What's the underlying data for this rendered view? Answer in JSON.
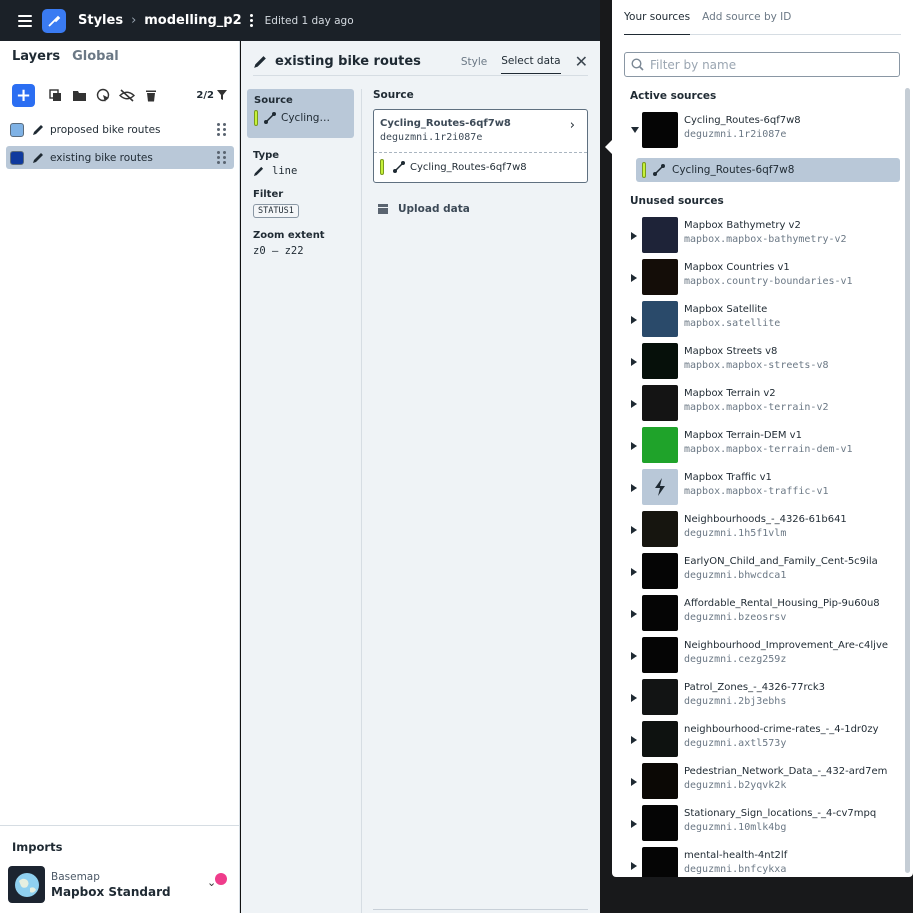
{
  "topbar": {
    "styles_label": "Styles",
    "style_name": "modelling_p2",
    "edited": "Edited 1 day ago"
  },
  "left": {
    "tabs": [
      "Layers",
      "Global"
    ],
    "count": "2/2",
    "layers": [
      {
        "name": "proposed bike routes",
        "color": "#7fb2e5",
        "selected": false
      },
      {
        "name": "existing bike routes",
        "color": "#0f3a9e",
        "selected": true
      }
    ],
    "imports": {
      "title": "Imports",
      "label": "Basemap",
      "name": "Mapbox Standard"
    }
  },
  "middle": {
    "title": "existing bike routes",
    "tabs": {
      "style": "Style",
      "select_data": "Select data"
    },
    "props": {
      "source_h": "Source",
      "source_val": "Cycling…",
      "type_h": "Type",
      "type_val": "line",
      "filter_h": "Filter",
      "filter_val": "STATUS1",
      "zoom_h": "Zoom extent",
      "zoom_val": "z0 – z22"
    },
    "source": {
      "header": "Source",
      "card_title": "Cycling_Routes-6qf7w8",
      "card_id": "deguzmni.1r2i087e",
      "card_layer": "Cycling_Routes-6qf7w8",
      "upload": "Upload data"
    }
  },
  "right": {
    "tabs": {
      "your_sources": "Your sources",
      "add_by_id": "Add source by ID"
    },
    "filter_placeholder": "Filter by name",
    "active_h": "Active sources",
    "active": {
      "name": "Cycling_Routes-6qf7w8",
      "id": "deguzmni.1r2i087e",
      "layer": "Cycling_Routes-6qf7w8"
    },
    "unused_h": "Unused sources",
    "unused": [
      {
        "name": "Mapbox Bathymetry v2",
        "id": "mapbox.mapbox-bathymetry-v2",
        "thumb": "#1e2338"
      },
      {
        "name": "Mapbox Countries v1",
        "id": "mapbox.country-boundaries-v1",
        "thumb": "#140d08"
      },
      {
        "name": "Mapbox Satellite",
        "id": "mapbox.satellite",
        "thumb": "#2a4a6a"
      },
      {
        "name": "Mapbox Streets v8",
        "id": "mapbox.mapbox-streets-v8",
        "thumb": "#06100a"
      },
      {
        "name": "Mapbox Terrain v2",
        "id": "mapbox.mapbox-terrain-v2",
        "thumb": "#141414"
      },
      {
        "name": "Mapbox Terrain-DEM v1",
        "id": "mapbox.mapbox-terrain-dem-v1",
        "thumb": "#1fa32a"
      },
      {
        "name": "Mapbox Traffic v1",
        "id": "mapbox.mapbox-traffic-v1",
        "thumb": "#b9c8d8"
      },
      {
        "name": "Neighbourhoods_-_4326-61b641",
        "id": "deguzmni.1h5f1vlm",
        "thumb": "#16150f"
      },
      {
        "name": "EarlyON_Child_and_Family_Cent-5c9ila",
        "id": "deguzmni.bhwcdca1",
        "thumb": "#050505"
      },
      {
        "name": "Affordable_Rental_Housing_Pip-9u60u8",
        "id": "deguzmni.bzeosrsv",
        "thumb": "#050505"
      },
      {
        "name": "Neighbourhood_Improvement_Are-c4ljve",
        "id": "deguzmni.cezg259z",
        "thumb": "#050505"
      },
      {
        "name": "Patrol_Zones_-_4326-77rck3",
        "id": "deguzmni.2bj3ebhs",
        "thumb": "#121414"
      },
      {
        "name": "neighbourhood-crime-rates_-_4-1dr0zy",
        "id": "deguzmni.axtl573y",
        "thumb": "#0e1210"
      },
      {
        "name": "Pedestrian_Network_Data_-_432-ard7em",
        "id": "deguzmni.b2yqvk2k",
        "thumb": "#0b0805"
      },
      {
        "name": "Stationary_Sign_locations_-_4-cv7mpq",
        "id": "deguzmni.10mlk4bg",
        "thumb": "#050505"
      },
      {
        "name": "mental-health-4nt2lf",
        "id": "deguzmni.bnfcykxa",
        "thumb": "#050505"
      }
    ]
  }
}
